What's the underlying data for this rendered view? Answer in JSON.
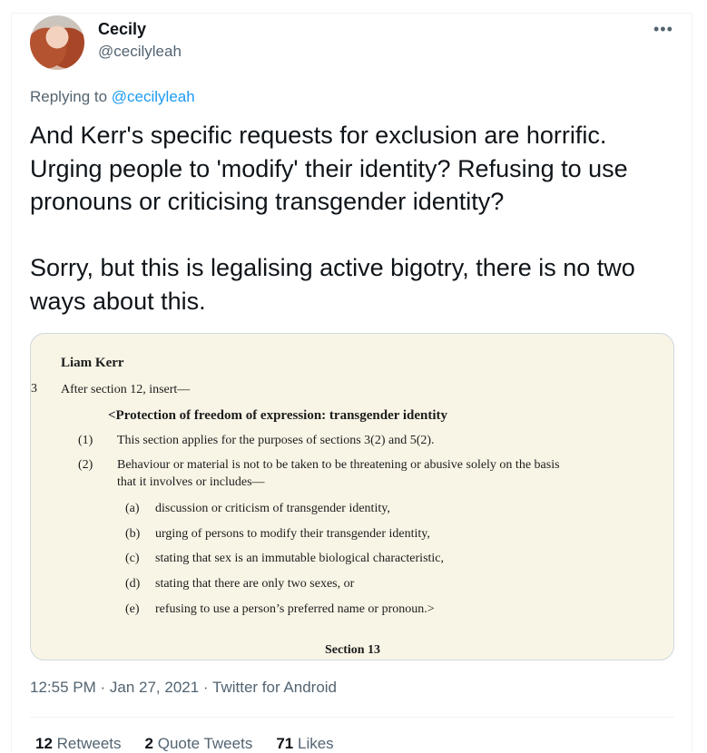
{
  "author": {
    "name": "Cecily",
    "handle": "@cecilyleah"
  },
  "more_icon": "more-dots-icon",
  "reply": {
    "prefix": "Replying to ",
    "to": "@cecilyleah"
  },
  "tweet": {
    "text": "And Kerr's specific requests for exclusion are horrific. Urging people to 'modify' their identity? Refusing to use pronouns or criticising transgender identity?\n\nSorry, but this is legalising active bigotry, there is no two ways about this."
  },
  "document": {
    "author": "Liam Kerr",
    "margin_mark": "3",
    "insert": "After section 12, insert—",
    "heading": "<Protection of freedom of expression: transgender identity",
    "clauses": [
      {
        "num": "(1)",
        "text": "This section applies for the purposes of sections 3(2) and 5(2)."
      },
      {
        "num": "(2)",
        "text": "Behaviour or material is not to be taken to be threatening or abusive solely on the basis",
        "cont": "that it involves or includes—"
      }
    ],
    "items": [
      {
        "num": "(a)",
        "text": "discussion or criticism of transgender identity,"
      },
      {
        "num": "(b)",
        "text": "urging of persons to modify their transgender identity,"
      },
      {
        "num": "(c)",
        "text": "stating that sex is an immutable biological characteristic,"
      },
      {
        "num": "(d)",
        "text": "stating that there are only two sexes, or"
      },
      {
        "num": "(e)",
        "text": "refusing to use a person’s preferred name or pronoun.>"
      }
    ],
    "next_section": "Section 13"
  },
  "meta": {
    "time": "12:55 PM",
    "sep1": " · ",
    "date": "Jan 27, 2021",
    "sep2": " · ",
    "client": "Twitter for Android"
  },
  "stats": {
    "retweets": "12",
    "retweets_label": "Retweets",
    "quotes": "2",
    "quotes_label": "Quote Tweets",
    "likes": "71",
    "likes_label": "Likes"
  }
}
